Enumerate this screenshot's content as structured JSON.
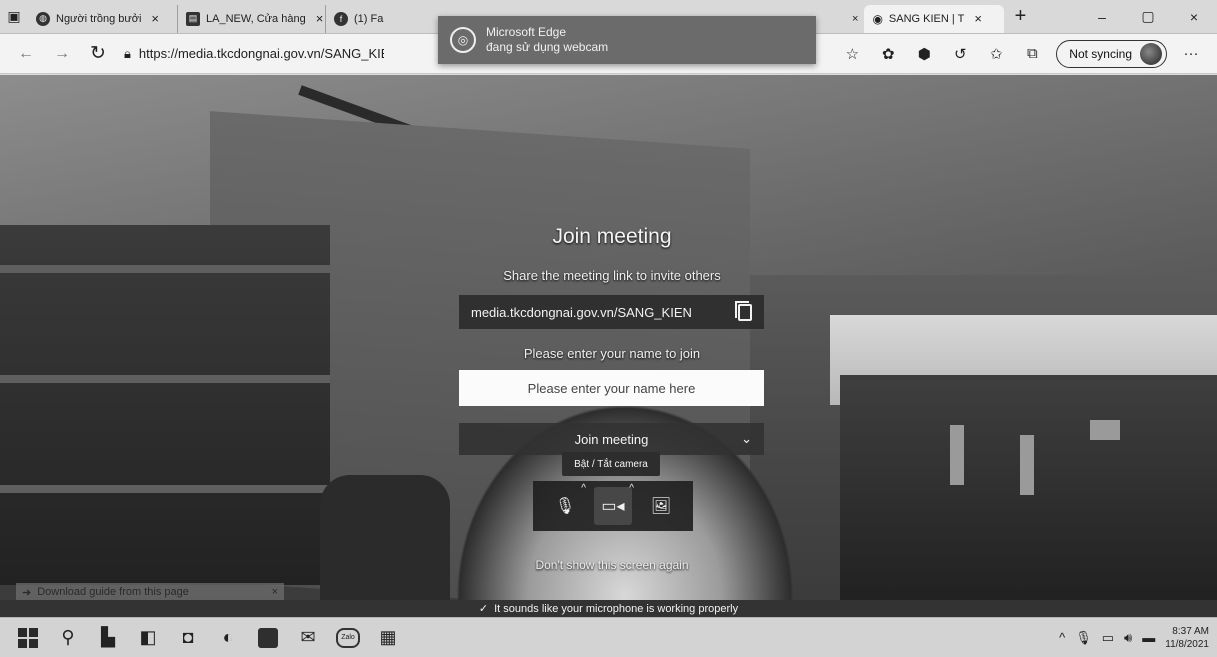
{
  "browser": {
    "tabs": [
      {
        "label": "Người trồng bưởi ",
        "close": "×"
      },
      {
        "label": "LA_NEW, Cửa hàng",
        "close": "×"
      },
      {
        "label": "(1) Fa",
        "close": ""
      },
      {
        "label": "SANG KIEN | T",
        "close": "×"
      }
    ],
    "new_tab": "+",
    "window_controls": {
      "minimize": "–",
      "maximize": "▢",
      "close": "×"
    },
    "url": "https://media.tkcdongnai.gov.vn/SANG_KIEN",
    "sync_label": "Not syncing",
    "more": "···"
  },
  "webcam_notice": {
    "title": "Microsoft Edge",
    "message": "đang sử dụng webcam"
  },
  "join": {
    "title": "Join meeting",
    "share_text": "Share the meeting link to invite others",
    "meeting_link": "media.tkcdongnai.gov.vn/SANG_KIEN",
    "name_label": "Please enter your name to join",
    "name_placeholder": "Please enter your name here",
    "join_button": "Join meeting",
    "camera_tooltip": "Bật / Tắt camera",
    "dont_show": "Don't show this screen again"
  },
  "download_guide": "Download guide from this page",
  "mic_status": "It sounds like your microphone is working properly",
  "taskbar": {
    "clock_time": "8:37 AM",
    "clock_date": "11/8/2021",
    "zalo": "Zalo"
  }
}
